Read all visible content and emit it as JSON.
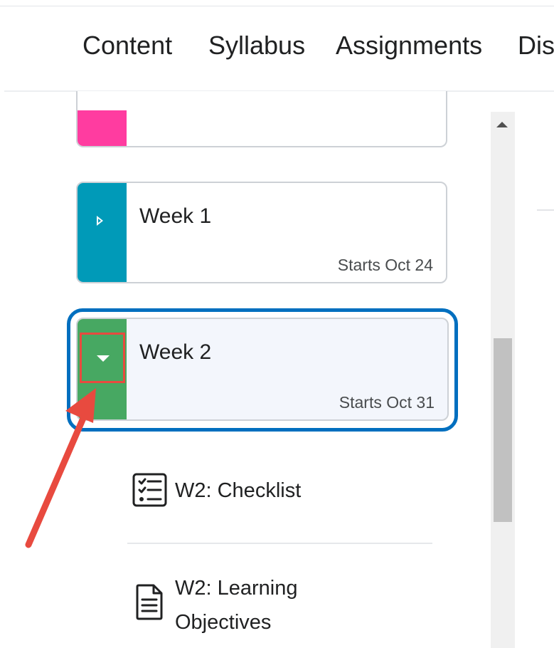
{
  "nav": {
    "items": [
      "Content",
      "Syllabus",
      "Assignments",
      "Dis"
    ]
  },
  "modules": [
    {
      "title": "",
      "starts": "",
      "color": "#ff3ca0"
    },
    {
      "title": "Week 1",
      "starts": "Starts Oct 24",
      "color": "#009ab8",
      "expanded": false
    },
    {
      "title": "Week 2",
      "starts": "Starts Oct 31",
      "color": "#47a862",
      "expanded": true,
      "selected": true
    }
  ],
  "topics": [
    {
      "label": "W2: Checklist",
      "icon": "checklist-icon"
    },
    {
      "label_line1": "W2: Learning",
      "label_line2": "Objectives",
      "icon": "document-icon"
    }
  ],
  "colors": {
    "focus_ring": "#006fbf",
    "annotation": "#e84a3f"
  }
}
